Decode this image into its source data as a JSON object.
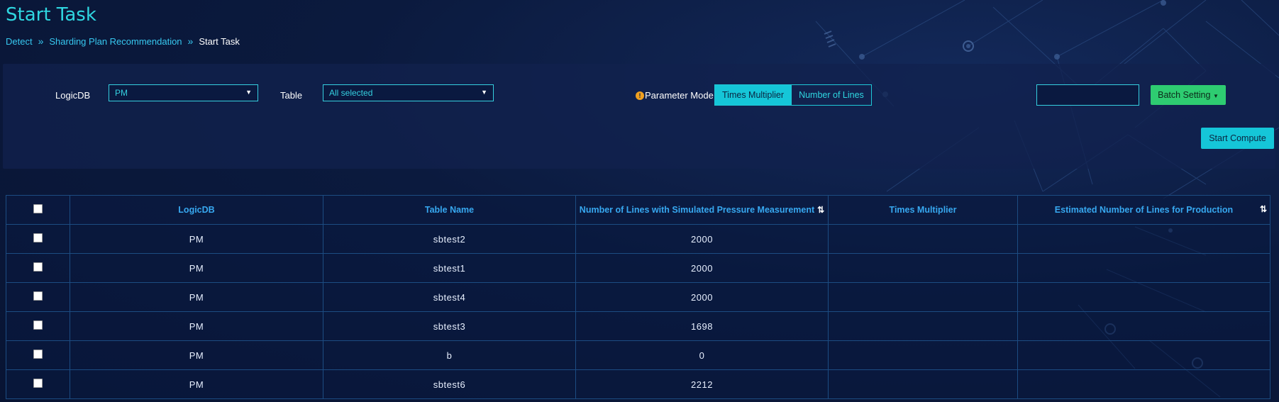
{
  "page": {
    "title": "Start Task"
  },
  "breadcrumb": {
    "item1": "Detect",
    "item2": "Sharding Plan Recommendation",
    "item3": "Start Task",
    "sep": "»"
  },
  "filters": {
    "logicdb_label": "LogicDB",
    "logicdb_value": "PM",
    "table_label": "Table",
    "table_value": "All selected",
    "param_mode_label": "Parameter Mode",
    "param_mode_info": "!",
    "mode_times": "Times Multiplier",
    "mode_lines": "Number of Lines",
    "batch_input_value": "",
    "batch_button": "Batch Setting",
    "start_button": "Start Compute"
  },
  "table": {
    "headers": {
      "logicdb": "LogicDB",
      "table_name": "Table Name",
      "simulated_lines": "Number of Lines with Simulated Pressure Measurement",
      "times_multiplier": "Times Multiplier",
      "estimated_lines": "Estimated Number of Lines for Production"
    },
    "rows": [
      {
        "logicdb": "PM",
        "table_name": "sbtest2",
        "simulated_lines": "2000",
        "times_multiplier": "",
        "estimated_lines": ""
      },
      {
        "logicdb": "PM",
        "table_name": "sbtest1",
        "simulated_lines": "2000",
        "times_multiplier": "",
        "estimated_lines": ""
      },
      {
        "logicdb": "PM",
        "table_name": "sbtest4",
        "simulated_lines": "2000",
        "times_multiplier": "",
        "estimated_lines": ""
      },
      {
        "logicdb": "PM",
        "table_name": "sbtest3",
        "simulated_lines": "1698",
        "times_multiplier": "",
        "estimated_lines": ""
      },
      {
        "logicdb": "PM",
        "table_name": "b",
        "simulated_lines": "0",
        "times_multiplier": "",
        "estimated_lines": ""
      },
      {
        "logicdb": "PM",
        "table_name": "sbtest6",
        "simulated_lines": "2212",
        "times_multiplier": "",
        "estimated_lines": ""
      }
    ]
  }
}
